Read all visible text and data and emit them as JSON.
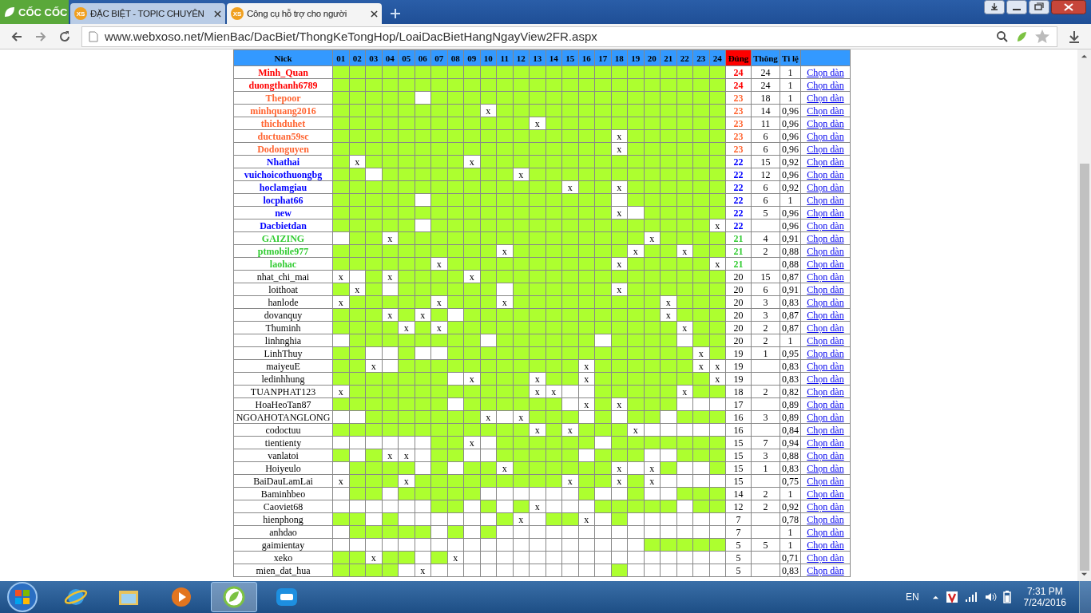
{
  "browser": {
    "logo": "CỐC CỐC",
    "tabs": [
      {
        "title": "ĐẶC BIỆT - TOPIC CHUYÊN",
        "badge": "XS",
        "selected": false
      },
      {
        "title": "Công cụ hỗ trợ cho người",
        "badge": "XS",
        "selected": true
      }
    ],
    "address": "www.webxoso.net/MienBac/DacBiet/ThongKeTongHop/LoaiDacBietHangNgayView2FR.aspx"
  },
  "table": {
    "columns": [
      "Nick",
      "01",
      "02",
      "03",
      "04",
      "05",
      "06",
      "07",
      "08",
      "09",
      "10",
      "11",
      "12",
      "13",
      "14",
      "15",
      "16",
      "17",
      "18",
      "19",
      "20",
      "21",
      "22",
      "23",
      "24",
      "Đúng",
      "Thông",
      "Ti lệ"
    ],
    "rows": [
      {
        "nick": "Minh_Quan",
        "color": "#ff0000",
        "days": [
          true,
          true,
          true,
          true,
          true,
          true,
          true,
          true,
          true,
          true,
          true,
          true,
          true,
          true,
          true,
          true,
          true,
          true,
          true,
          true,
          true,
          true,
          true,
          true
        ],
        "dung": "24",
        "thong": "24",
        "ti_le": "1",
        "link": "Chọn dàn"
      },
      {
        "nick": "duongthanh6789",
        "color": "#ff0000",
        "days": [
          true,
          true,
          true,
          true,
          true,
          true,
          true,
          true,
          true,
          true,
          true,
          true,
          true,
          true,
          true,
          true,
          true,
          true,
          true,
          true,
          true,
          true,
          true,
          true
        ],
        "dung": "24",
        "thong": "24",
        "ti_le": "1",
        "link": "Chọn dàn"
      },
      {
        "nick": "Thepoor",
        "color": "#ff6633",
        "days": [
          true,
          true,
          true,
          true,
          true,
          false,
          true,
          true,
          true,
          true,
          true,
          true,
          true,
          true,
          true,
          true,
          true,
          true,
          true,
          true,
          true,
          true,
          true,
          true
        ],
        "dung": "23",
        "thong": "18",
        "ti_le": "1",
        "link": "Chọn dàn"
      },
      {
        "nick": "minhquang2016",
        "color": "#ff6633",
        "days": [
          true,
          true,
          true,
          true,
          true,
          true,
          true,
          true,
          true,
          "x",
          true,
          true,
          true,
          true,
          true,
          true,
          true,
          true,
          true,
          true,
          true,
          true,
          true,
          true
        ],
        "dung": "23",
        "thong": "14",
        "ti_le": "0,96",
        "link": "Chọn dàn"
      },
      {
        "nick": "thichduhet",
        "color": "#ff6633",
        "days": [
          true,
          true,
          true,
          true,
          true,
          true,
          true,
          true,
          true,
          true,
          true,
          true,
          "x",
          true,
          true,
          true,
          true,
          true,
          true,
          true,
          true,
          true,
          true,
          true
        ],
        "dung": "23",
        "thong": "11",
        "ti_le": "0,96",
        "link": "Chọn dàn"
      },
      {
        "nick": "ductuan59sc",
        "color": "#ff6633",
        "days": [
          true,
          true,
          true,
          true,
          true,
          true,
          true,
          true,
          true,
          true,
          true,
          true,
          true,
          true,
          true,
          true,
          true,
          "x",
          true,
          true,
          true,
          true,
          true,
          true
        ],
        "dung": "23",
        "thong": "6",
        "ti_le": "0,96",
        "link": "Chọn dàn"
      },
      {
        "nick": "Dodonguyen",
        "color": "#ff6633",
        "days": [
          true,
          true,
          true,
          true,
          true,
          true,
          true,
          true,
          true,
          true,
          true,
          true,
          true,
          true,
          true,
          true,
          true,
          "x",
          true,
          true,
          true,
          true,
          true,
          true
        ],
        "dung": "23",
        "thong": "6",
        "ti_le": "0,96",
        "link": "Chọn dàn"
      },
      {
        "nick": "Nhathai",
        "color": "#0000ff",
        "days": [
          true,
          "x",
          true,
          true,
          true,
          true,
          true,
          true,
          "x",
          true,
          true,
          true,
          true,
          true,
          true,
          true,
          true,
          true,
          true,
          true,
          true,
          true,
          true,
          true
        ],
        "dung": "22",
        "thong": "15",
        "ti_le": "0,92",
        "link": "Chọn dàn"
      },
      {
        "nick": "vuichoicothuongbg",
        "color": "#0000ff",
        "days": [
          true,
          true,
          false,
          true,
          true,
          true,
          true,
          true,
          true,
          true,
          true,
          "x",
          true,
          true,
          true,
          true,
          true,
          true,
          true,
          true,
          true,
          true,
          true,
          true
        ],
        "dung": "22",
        "thong": "12",
        "ti_le": "0,96",
        "link": "Chọn dàn"
      },
      {
        "nick": "hoclamgiau",
        "color": "#0000ff",
        "days": [
          true,
          true,
          true,
          true,
          true,
          true,
          true,
          true,
          true,
          true,
          true,
          true,
          true,
          true,
          "x",
          true,
          true,
          "x",
          true,
          true,
          true,
          true,
          true,
          true
        ],
        "dung": "22",
        "thong": "6",
        "ti_le": "0,92",
        "link": "Chọn dàn"
      },
      {
        "nick": "locphat66",
        "color": "#0000ff",
        "days": [
          true,
          true,
          true,
          true,
          true,
          false,
          true,
          true,
          true,
          true,
          true,
          true,
          true,
          true,
          true,
          true,
          true,
          false,
          true,
          true,
          true,
          true,
          true,
          true
        ],
        "dung": "22",
        "thong": "6",
        "ti_le": "1",
        "link": "Chọn dàn"
      },
      {
        "nick": "new",
        "color": "#0000ff",
        "days": [
          true,
          true,
          true,
          true,
          true,
          true,
          true,
          true,
          true,
          true,
          true,
          true,
          true,
          true,
          true,
          true,
          true,
          "x",
          false,
          true,
          true,
          true,
          true,
          true
        ],
        "dung": "22",
        "thong": "5",
        "ti_le": "0,96",
        "link": "Chọn dàn"
      },
      {
        "nick": "Dacbietdan",
        "color": "#0000ff",
        "days": [
          true,
          true,
          true,
          true,
          true,
          false,
          true,
          true,
          true,
          true,
          true,
          true,
          true,
          true,
          true,
          true,
          true,
          true,
          true,
          true,
          true,
          true,
          true,
          "x"
        ],
        "dung": "22",
        "ti_le": "0,96",
        "link": "Chọn dàn"
      },
      {
        "nick": "GAIZING",
        "color": "#33cc33",
        "days": [
          false,
          true,
          true,
          "x",
          true,
          true,
          true,
          true,
          true,
          true,
          true,
          true,
          true,
          true,
          true,
          true,
          true,
          true,
          true,
          "x",
          true,
          true,
          true,
          true
        ],
        "dung": "21",
        "thong": "4",
        "ti_le": "0,91",
        "link": "Chọn dàn"
      },
      {
        "nick": "ptmobile977",
        "color": "#33cc33",
        "days": [
          true,
          true,
          true,
          true,
          true,
          true,
          true,
          true,
          true,
          true,
          "x",
          true,
          true,
          true,
          true,
          true,
          true,
          true,
          "x",
          true,
          true,
          "x",
          true,
          true
        ],
        "dung": "21",
        "thong": "2",
        "ti_le": "0,88",
        "link": "Chọn dàn"
      },
      {
        "nick": "laohac",
        "color": "#33cc33",
        "days": [
          true,
          true,
          true,
          true,
          true,
          true,
          "x",
          true,
          true,
          true,
          true,
          true,
          true,
          true,
          true,
          true,
          true,
          "x",
          true,
          true,
          true,
          true,
          true,
          "x"
        ],
        "dung": "21",
        "ti_le": "0,88",
        "link": "Chọn dàn"
      },
      {
        "nick": "nhat_chi_mai",
        "days": [
          "x",
          false,
          true,
          "x",
          true,
          true,
          true,
          true,
          "x",
          true,
          true,
          true,
          true,
          true,
          true,
          true,
          true,
          true,
          true,
          true,
          true,
          true,
          true,
          true
        ],
        "dung": "20",
        "thong": "15",
        "ti_le": "0,87",
        "link": "Chọn dàn"
      },
      {
        "nick": "loithoat",
        "days": [
          true,
          "x",
          true,
          false,
          true,
          true,
          true,
          true,
          true,
          true,
          false,
          true,
          true,
          true,
          true,
          true,
          true,
          "x",
          true,
          true,
          true,
          true,
          true,
          true
        ],
        "dung": "20",
        "thong": "6",
        "ti_le": "0,91",
        "link": "Chọn dàn"
      },
      {
        "nick": "hanlode",
        "days": [
          "x",
          true,
          true,
          true,
          true,
          true,
          "x",
          true,
          true,
          true,
          "x",
          true,
          true,
          true,
          true,
          true,
          true,
          true,
          true,
          true,
          "x",
          true,
          true,
          true
        ],
        "dung": "20",
        "thong": "3",
        "ti_le": "0,83",
        "link": "Chọn dàn"
      },
      {
        "nick": "dovanquy",
        "days": [
          true,
          true,
          true,
          "x",
          true,
          "x",
          true,
          false,
          true,
          true,
          true,
          true,
          true,
          true,
          true,
          true,
          true,
          true,
          true,
          true,
          "x",
          true,
          true,
          true
        ],
        "dung": "20",
        "thong": "3",
        "ti_le": "0,87",
        "link": "Chọn dàn"
      },
      {
        "nick": "Thuminh",
        "days": [
          true,
          true,
          true,
          true,
          "x",
          true,
          "x",
          true,
          true,
          true,
          true,
          true,
          true,
          true,
          true,
          true,
          true,
          true,
          true,
          true,
          true,
          "x",
          true,
          true
        ],
        "dung": "20",
        "thong": "2",
        "ti_le": "0,87",
        "link": "Chọn dàn"
      },
      {
        "nick": "linhnghia",
        "days": [
          false,
          true,
          true,
          true,
          true,
          true,
          true,
          true,
          true,
          false,
          true,
          true,
          true,
          true,
          true,
          true,
          false,
          true,
          true,
          true,
          true,
          false,
          true,
          true
        ],
        "dung": "20",
        "thong": "2",
        "ti_le": "1",
        "link": "Chọn dàn"
      },
      {
        "nick": "LinhThuy",
        "days": [
          true,
          true,
          false,
          false,
          true,
          false,
          false,
          true,
          true,
          true,
          true,
          true,
          true,
          true,
          true,
          true,
          true,
          true,
          true,
          true,
          true,
          true,
          "x",
          true
        ],
        "dung": "19",
        "thong": "1",
        "ti_le": "0,95",
        "link": "Chọn dàn"
      },
      {
        "nick": "maiyeuE",
        "days": [
          true,
          true,
          "x",
          false,
          true,
          true,
          true,
          true,
          true,
          true,
          true,
          true,
          true,
          true,
          true,
          "x",
          true,
          true,
          true,
          true,
          true,
          true,
          "x",
          "x"
        ],
        "dung": "19",
        "ti_le": "0,83",
        "link": "Chọn dàn"
      },
      {
        "nick": "ledinhhung",
        "days": [
          true,
          true,
          true,
          true,
          true,
          true,
          true,
          false,
          "x",
          true,
          true,
          true,
          "x",
          true,
          true,
          "x",
          true,
          true,
          true,
          true,
          true,
          true,
          true,
          "x"
        ],
        "dung": "19",
        "ti_le": "0,83",
        "link": "Chọn dàn"
      },
      {
        "nick": "TUANPHAT123",
        "days": [
          "x",
          true,
          true,
          true,
          true,
          true,
          true,
          true,
          true,
          true,
          true,
          true,
          "x",
          "x",
          false,
          false,
          true,
          true,
          true,
          true,
          true,
          "x",
          true,
          true
        ],
        "dung": "18",
        "thong": "2",
        "ti_le": "0,82",
        "link": "Chọn dàn"
      },
      {
        "nick": "HoaHeoTan87",
        "days": [
          true,
          true,
          true,
          true,
          true,
          true,
          true,
          false,
          true,
          true,
          true,
          true,
          true,
          true,
          false,
          "x",
          true,
          "x",
          true,
          true,
          true,
          false,
          false,
          false
        ],
        "dung": "17",
        "ti_le": "0,89",
        "link": "Chọn dàn"
      },
      {
        "nick": "NGOAHOTANGLONG",
        "days": [
          false,
          false,
          true,
          true,
          true,
          true,
          true,
          true,
          true,
          "x",
          false,
          "x",
          true,
          true,
          true,
          false,
          true,
          false,
          true,
          true,
          false,
          true,
          true,
          true
        ],
        "dung": "16",
        "thong": "3",
        "ti_le": "0,89",
        "link": "Chọn dàn"
      },
      {
        "nick": "codoctuu",
        "days": [
          true,
          true,
          true,
          true,
          true,
          true,
          true,
          true,
          true,
          true,
          true,
          true,
          "x",
          true,
          "x",
          true,
          true,
          true,
          "x",
          false,
          false,
          false,
          false,
          false
        ],
        "dung": "16",
        "ti_le": "0,84",
        "link": "Chọn dàn"
      },
      {
        "nick": "tientienty",
        "days": [
          false,
          false,
          false,
          false,
          false,
          false,
          true,
          true,
          "x",
          false,
          true,
          true,
          true,
          true,
          true,
          true,
          false,
          true,
          true,
          true,
          true,
          true,
          true,
          true
        ],
        "dung": "15",
        "thong": "7",
        "ti_le": "0,94",
        "link": "Chọn dàn"
      },
      {
        "nick": "vanlatoi",
        "days": [
          true,
          false,
          true,
          "x",
          "x",
          false,
          true,
          true,
          false,
          false,
          true,
          true,
          true,
          true,
          true,
          false,
          true,
          true,
          true,
          false,
          false,
          true,
          true,
          true
        ],
        "dung": "15",
        "thong": "3",
        "ti_le": "0,88",
        "link": "Chọn dàn"
      },
      {
        "nick": "Hoiyeulo",
        "days": [
          false,
          true,
          true,
          true,
          true,
          false,
          true,
          false,
          true,
          true,
          "x",
          true,
          true,
          true,
          true,
          true,
          true,
          "x",
          false,
          "x",
          true,
          false,
          false,
          true
        ],
        "dung": "15",
        "thong": "1",
        "ti_le": "0,83",
        "link": "Chọn dàn"
      },
      {
        "nick": "BaiDauLamLai",
        "days": [
          "x",
          true,
          true,
          true,
          "x",
          true,
          true,
          true,
          true,
          true,
          true,
          true,
          true,
          true,
          "x",
          true,
          true,
          "x",
          true,
          "x",
          false,
          false,
          false,
          false
        ],
        "dung": "15",
        "ti_le": "0,75",
        "link": "Chọn dàn"
      },
      {
        "nick": "Baminhbeo",
        "days": [
          false,
          true,
          true,
          false,
          true,
          true,
          true,
          true,
          true,
          false,
          false,
          false,
          false,
          false,
          false,
          true,
          false,
          false,
          true,
          false,
          false,
          true,
          true,
          true
        ],
        "dung": "14",
        "thong": "2",
        "ti_le": "1",
        "link": "Chọn dàn"
      },
      {
        "nick": "Caoviet68",
        "days": [
          false,
          false,
          false,
          false,
          false,
          false,
          true,
          true,
          false,
          true,
          false,
          true,
          "x",
          false,
          false,
          false,
          true,
          true,
          true,
          true,
          true,
          false,
          true,
          true
        ],
        "dung": "12",
        "thong": "2",
        "ti_le": "0,92",
        "link": "Chọn dàn"
      },
      {
        "nick": "hienphong",
        "days": [
          true,
          true,
          false,
          true,
          false,
          false,
          false,
          false,
          false,
          false,
          true,
          "x",
          false,
          true,
          true,
          "x",
          false,
          true,
          false,
          false,
          false,
          false,
          false,
          false
        ],
        "dung": "7",
        "ti_le": "0,78",
        "link": "Chọn dàn"
      },
      {
        "nick": "anhdao",
        "days": [
          false,
          true,
          true,
          true,
          true,
          true,
          false,
          true,
          false,
          true,
          false,
          false,
          false,
          false,
          false,
          false,
          false,
          false,
          false,
          false,
          false,
          false,
          false,
          false
        ],
        "dung": "7",
        "ti_le": "1",
        "link": "Chọn dàn"
      },
      {
        "nick": "gaimientay",
        "days": [
          false,
          false,
          false,
          false,
          false,
          false,
          false,
          false,
          false,
          false,
          false,
          false,
          false,
          false,
          false,
          false,
          false,
          false,
          false,
          true,
          true,
          true,
          true,
          true
        ],
        "dung": "5",
        "thong": "5",
        "ti_le": "1",
        "link": "Chọn dàn"
      },
      {
        "nick": "xeko",
        "days": [
          true,
          true,
          "x",
          true,
          true,
          false,
          true,
          "x",
          false,
          false,
          false,
          false,
          false,
          false,
          false,
          false,
          false,
          false,
          false,
          false,
          false,
          false,
          false,
          false
        ],
        "dung": "5",
        "ti_le": "0,71",
        "link": "Chọn dàn"
      },
      {
        "nick": "mien_dat_hua",
        "days": [
          true,
          true,
          true,
          true,
          false,
          "x",
          false,
          false,
          false,
          false,
          false,
          false,
          false,
          false,
          false,
          false,
          false,
          true,
          false,
          false,
          false,
          false,
          false,
          false
        ],
        "dung": "5",
        "ti_le": "0,83",
        "link": "Chọn dàn"
      }
    ]
  },
  "taskbar": {
    "language": "EN",
    "time": "7:31 PM",
    "date": "7/24/2016"
  }
}
